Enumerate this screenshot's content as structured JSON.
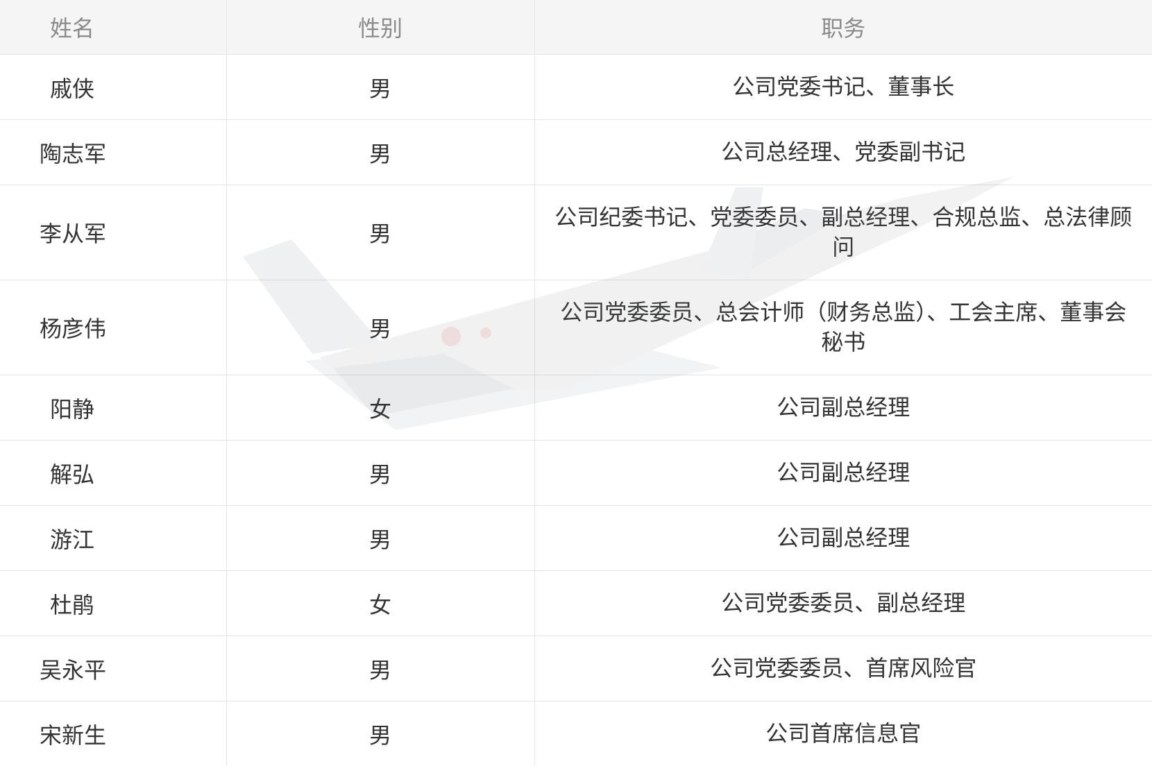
{
  "table": {
    "headers": {
      "name": "姓名",
      "sex": "性别",
      "duty": "职务"
    },
    "rows": [
      {
        "name": "戚侠",
        "sex": "男",
        "duty": "公司党委书记、董事长"
      },
      {
        "name": "陶志军",
        "sex": "男",
        "duty": "公司总经理、党委副书记"
      },
      {
        "name": "李从军",
        "sex": "男",
        "duty": "公司纪委书记、党委委员、副总经理、合规总监、总法律顾问"
      },
      {
        "name": "杨彦伟",
        "sex": "男",
        "duty": "公司党委委员、总会计师（财务总监）、工会主席、董事会秘书"
      },
      {
        "name": "阳静",
        "sex": "女",
        "duty": "公司副总经理"
      },
      {
        "name": "解弘",
        "sex": "男",
        "duty": "公司副总经理"
      },
      {
        "name": "游江",
        "sex": "男",
        "duty": "公司副总经理"
      },
      {
        "name": "杜鹃",
        "sex": "女",
        "duty": "公司党委委员、副总经理"
      },
      {
        "name": "吴永平",
        "sex": "男",
        "duty": "公司党委委员、首席风险官"
      },
      {
        "name": "宋新生",
        "sex": "男",
        "duty": "公司首席信息官"
      }
    ]
  },
  "watermark": {
    "icon": "fighter-jet-watermark-icon"
  }
}
